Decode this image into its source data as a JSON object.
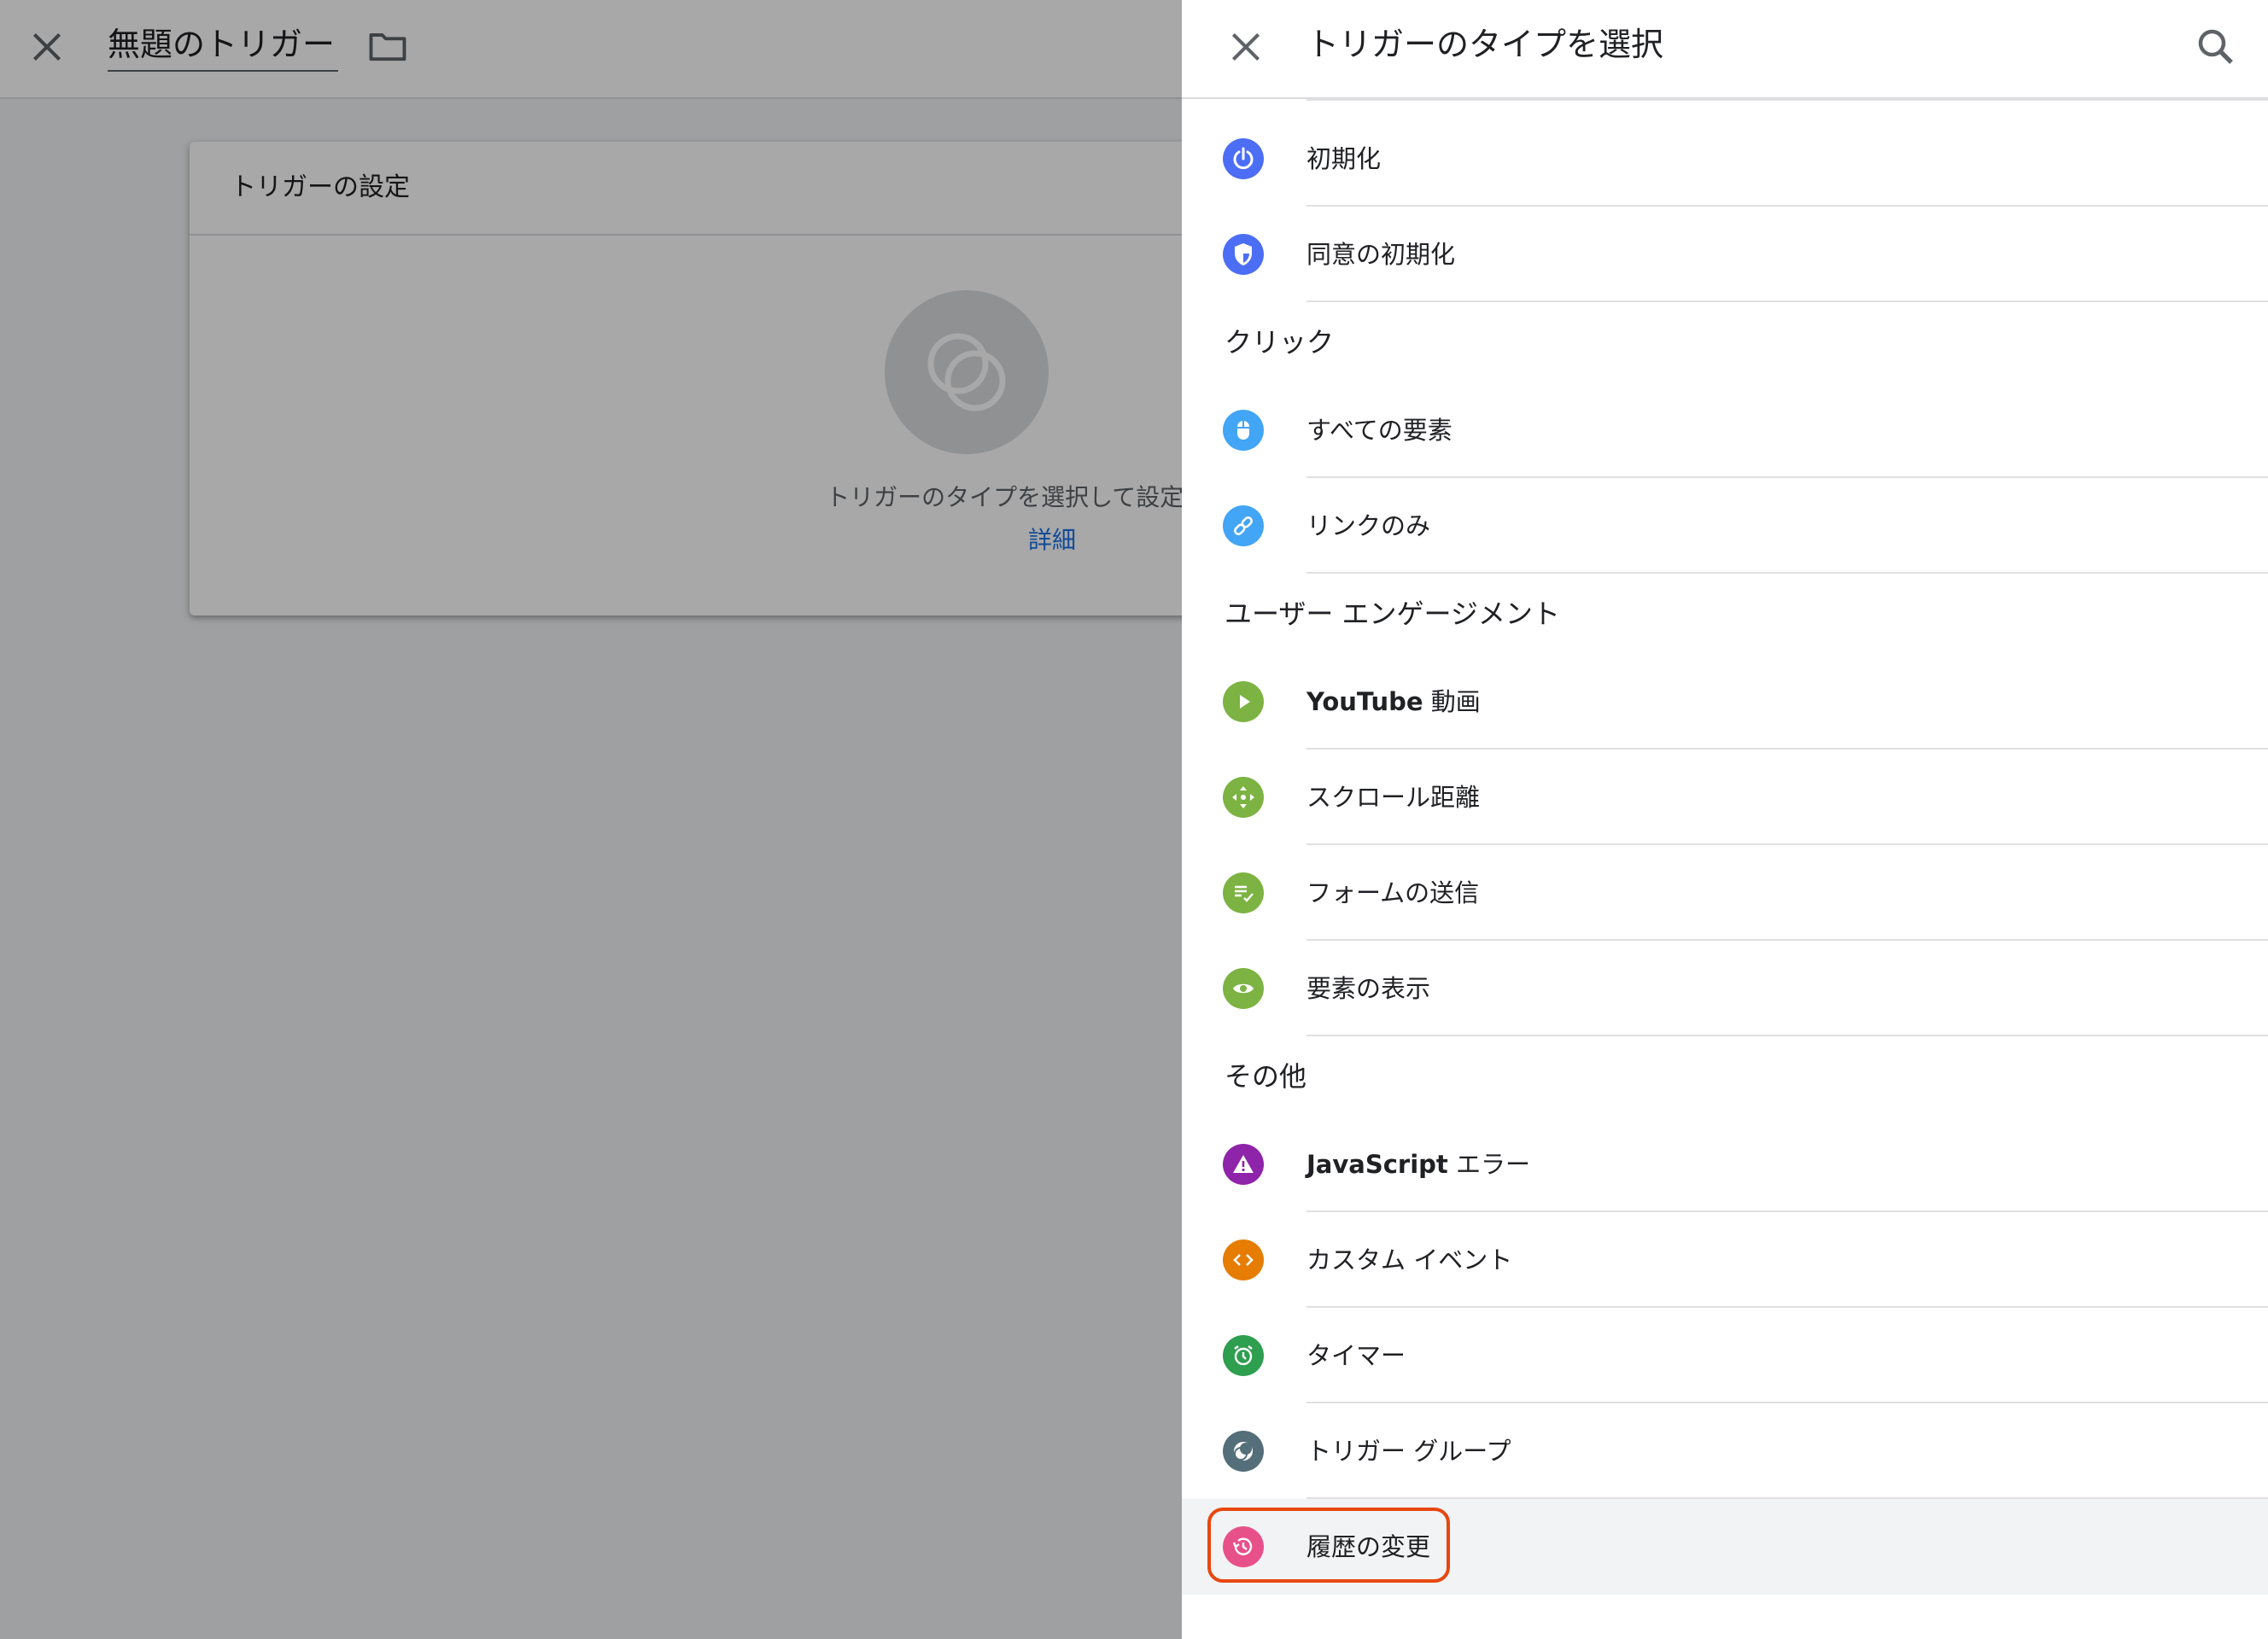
{
  "editor": {
    "title": "無題のトリガー",
    "card_title": "トリガーの設定",
    "hint": "トリガーのタイプを選択して設定を開始...",
    "link": "詳細"
  },
  "panel": {
    "title": "トリガーのタイプを選択",
    "top_items": [
      {
        "label": "初期化",
        "icon": "power-icon",
        "color": "#4c6ef5"
      },
      {
        "label": "同意の初期化",
        "icon": "shield-icon",
        "color": "#4c6ef5"
      }
    ],
    "sections": [
      {
        "header": "クリック",
        "items": [
          {
            "label": "すべての要素",
            "icon": "mouse-icon",
            "color": "#42a5f5"
          },
          {
            "label": "リンクのみ",
            "icon": "link-icon",
            "color": "#42a5f5"
          }
        ]
      },
      {
        "header": "ユーザー エンゲージメント",
        "items": [
          {
            "label_bold": "YouTube",
            "label": " 動画",
            "icon": "play-icon",
            "color": "#7cb342"
          },
          {
            "label": "スクロール距離",
            "icon": "scroll-move-icon",
            "color": "#7cb342"
          },
          {
            "label": "フォームの送信",
            "icon": "form-check-icon",
            "color": "#7cb342"
          },
          {
            "label": "要素の表示",
            "icon": "eye-icon",
            "color": "#7cb342"
          }
        ]
      },
      {
        "header": "その他",
        "items": [
          {
            "label_bold": "JavaScript",
            "label": " エラー",
            "icon": "warning-icon",
            "color": "#8e24aa"
          },
          {
            "label": "カスタム イベント",
            "icon": "code-icon",
            "color": "#e67c00"
          },
          {
            "label": "タイマー",
            "icon": "alarm-icon",
            "color": "#2e9e4f"
          },
          {
            "label": "トリガー グループ",
            "icon": "trigger-group-icon",
            "color": "#546e7a"
          },
          {
            "label": "履歴の変更",
            "icon": "history-icon",
            "color": "#e8508a",
            "highlighted": true
          }
        ]
      }
    ]
  }
}
